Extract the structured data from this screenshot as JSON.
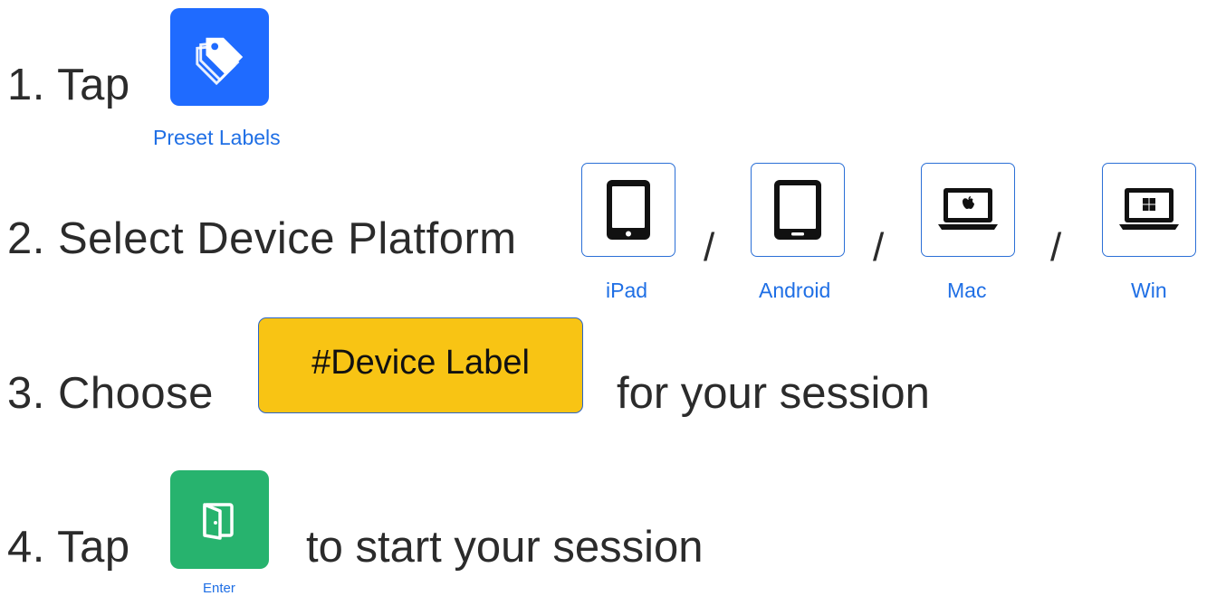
{
  "steps": {
    "step1": {
      "text": "1. Tap",
      "icon": "tag-icon",
      "icon_color": "#1f6bff",
      "caption": "Preset Labels"
    },
    "step2": {
      "text": "2. Select Device Platform",
      "separator": "/",
      "platforms": [
        {
          "label": "iPad",
          "icon": "tablet-icon"
        },
        {
          "label": "Android",
          "icon": "android-tablet-icon"
        },
        {
          "label": "Mac",
          "icon": "apple-laptop-icon"
        },
        {
          "label": "Win",
          "icon": "windows-laptop-icon"
        }
      ]
    },
    "step3": {
      "prefix": "3. Choose",
      "button_label": "#Device Label",
      "button_color": "#f8c414",
      "suffix": "for your session"
    },
    "step4": {
      "prefix": "4. Tap",
      "icon": "door-enter-icon",
      "icon_color": "#27b36e",
      "caption": "Enter",
      "suffix": "to start your session"
    }
  },
  "colors": {
    "caption": "#1f6fe5",
    "border": "#2b6fd6",
    "text": "#2b2b2b"
  }
}
